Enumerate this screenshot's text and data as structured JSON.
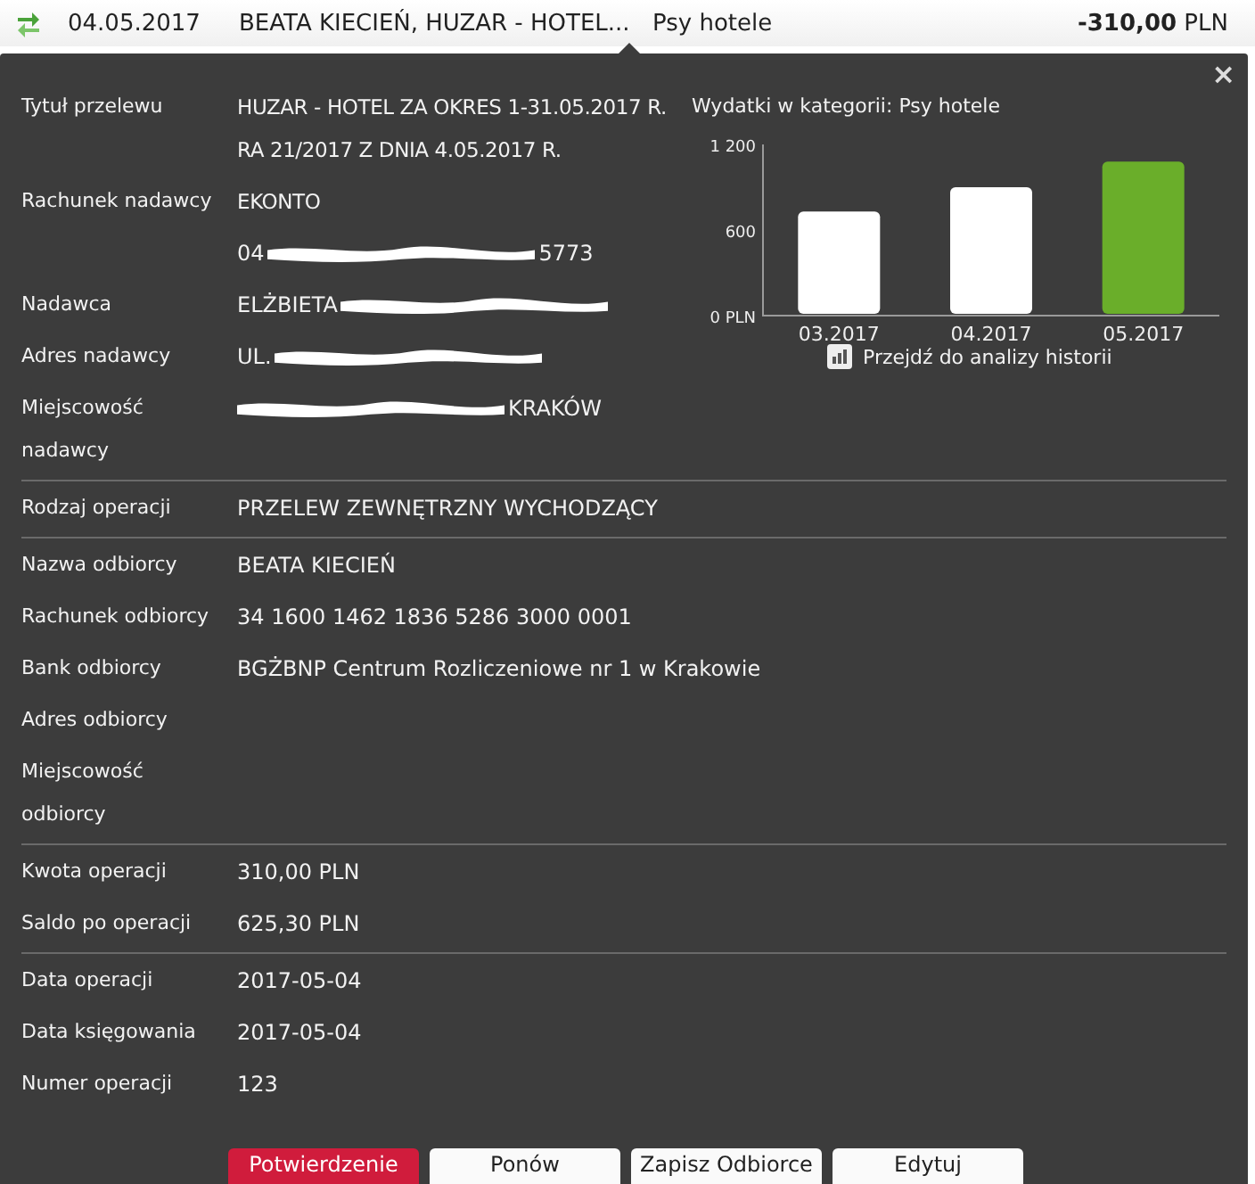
{
  "transaction": {
    "date": "04.05.2017",
    "description": "BEATA KIECIEŃ, HUZAR - HOTEL...",
    "category": "Psy hotele",
    "amount": "**-310,00** PLN"
  },
  "details": {
    "close": "×",
    "sections": [
      {
        "rows": [
          {
            "label": "Tytuł przelewu",
            "parts": [
              {
                "kind": "text",
                "text": "HUZAR - HOTEL ZA OKRES 1-31.05.2017 R. RA 21/2017 Z DNIA 4.05.2017 R."
              }
            ]
          },
          {
            "label": "Rachunek nadawcy",
            "parts": [
              {
                "kind": "text",
                "text": "EKONTO"
              }
            ]
          },
          {
            "parts": [
              {
                "kind": "text",
                "text": "04"
              },
              {
                "kind": "redaction"
              },
              {
                "kind": "text",
                "text": "5773"
              }
            ]
          },
          {
            "label": "Nadawca",
            "parts": [
              {
                "kind": "text",
                "text": "ELŻBIETA"
              },
              {
                "kind": "redaction"
              }
            ]
          },
          {
            "label": "Adres nadawcy",
            "parts": [
              {
                "kind": "text",
                "text": "UL."
              },
              {
                "kind": "redaction"
              }
            ]
          },
          {
            "label": "Miejscowość nadawcy",
            "parts": [
              {
                "kind": "redaction"
              },
              {
                "kind": "text",
                "text": "KRAKÓW"
              }
            ]
          }
        ],
        "chart": {
          "title": "Wydatki w kategorii:  Psy hotele",
          "link": "Przejdź do analizy historii",
          "chart_data": {
            "type": "bar",
            "categories": [
              "03.2017",
              "04.2017",
              "05.2017"
            ],
            "series": [
              {
                "color": "#ffffff",
                "values": [
                  730,
                  900,
                  null
                ]
              },
              {
                "color": "#6aae2a",
                "values": [
                  null,
                  null,
                  1080
                ]
              }
            ],
            "ylim": [
              0,
              1200
            ],
            "yticks": [
              {
                "value": 0,
                "label": "0 PLN"
              },
              {
                "value": 600,
                "label": "600"
              },
              {
                "value": 1200,
                "label": "1 200"
              }
            ]
          }
        }
      },
      {
        "rows": [
          {
            "label": "Rodzaj operacji",
            "parts": [
              {
                "kind": "text",
                "text": "PRZELEW ZEWNĘTRZNY WYCHODZĄCY"
              }
            ]
          }
        ]
      },
      {
        "rows": [
          {
            "label": "Nazwa odbiorcy",
            "parts": [
              {
                "kind": "text",
                "text": "BEATA KIECIEŃ"
              }
            ]
          },
          {
            "label": "Rachunek odbiorcy",
            "parts": [
              {
                "kind": "text",
                "text": "34 1600 1462 1836 5286 3000 0001"
              }
            ]
          },
          {
            "label": "Bank odbiorcy",
            "parts": [
              {
                "kind": "text",
                "text": "BGŻBNP Centrum Rozliczeniowe nr 1 w Krakowie"
              }
            ]
          },
          {
            "label": "Adres odbiorcy"
          },
          {
            "label": "Miejscowość odbiorcy"
          }
        ]
      },
      {
        "rows": [
          {
            "label": "Kwota operacji",
            "parts": [
              {
                "kind": "text",
                "text": "310,00 PLN"
              }
            ]
          },
          {
            "label": "Saldo po operacji",
            "parts": [
              {
                "kind": "text",
                "text": "625,30 PLN"
              }
            ]
          }
        ]
      },
      {
        "rows": [
          {
            "label": "Data operacji",
            "parts": [
              {
                "kind": "text",
                "text": "2017-05-04"
              }
            ]
          },
          {
            "label": "Data księgowania",
            "parts": [
              {
                "kind": "text",
                "text": "2017-05-04"
              }
            ]
          },
          {
            "label": "Numer operacji",
            "parts": [
              {
                "kind": "text",
                "text": "123"
              }
            ]
          }
        ]
      }
    ],
    "buttons": [
      {
        "label": "Potwierdzenie",
        "kind": "primary"
      },
      {
        "label": "Ponów",
        "kind": "secondary"
      },
      {
        "label": "Zapisz Odbiorce",
        "kind": "secondary"
      },
      {
        "label": "Edytuj",
        "kind": "secondary"
      }
    ]
  }
}
